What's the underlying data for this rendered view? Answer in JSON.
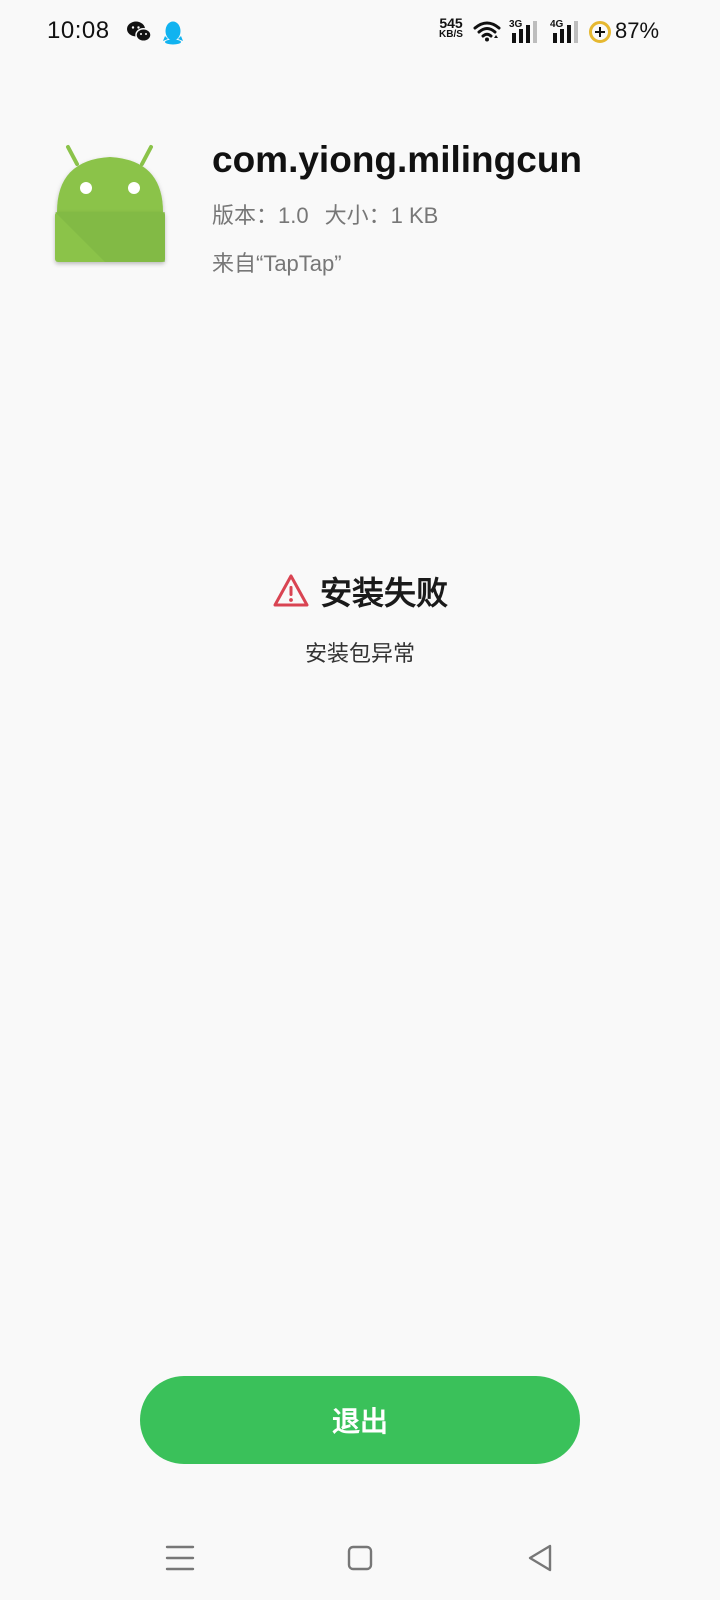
{
  "status_bar": {
    "time": "10:08",
    "net_speed_value": "545",
    "net_speed_unit": "KB/S",
    "sim1_type": "3G",
    "sim2_type": "4G",
    "battery_percent": "87%",
    "icons": [
      "wechat-icon",
      "qq-icon",
      "wifi-icon",
      "signal-icon",
      "battery-saver-icon"
    ]
  },
  "app": {
    "package_name": "com.yiong.milingcun",
    "version": "版本：1.0",
    "size": "大小：1 KB",
    "source": "来自“TapTap”",
    "icon": "android-default-icon"
  },
  "result": {
    "title": "安装失败",
    "message": "安装包异常",
    "status_color": "#d94452"
  },
  "actions": {
    "exit_label": "退出",
    "exit_color": "#3ac15a"
  },
  "nav_bar": {
    "items": [
      "menu-icon",
      "home-icon",
      "back-icon"
    ]
  }
}
